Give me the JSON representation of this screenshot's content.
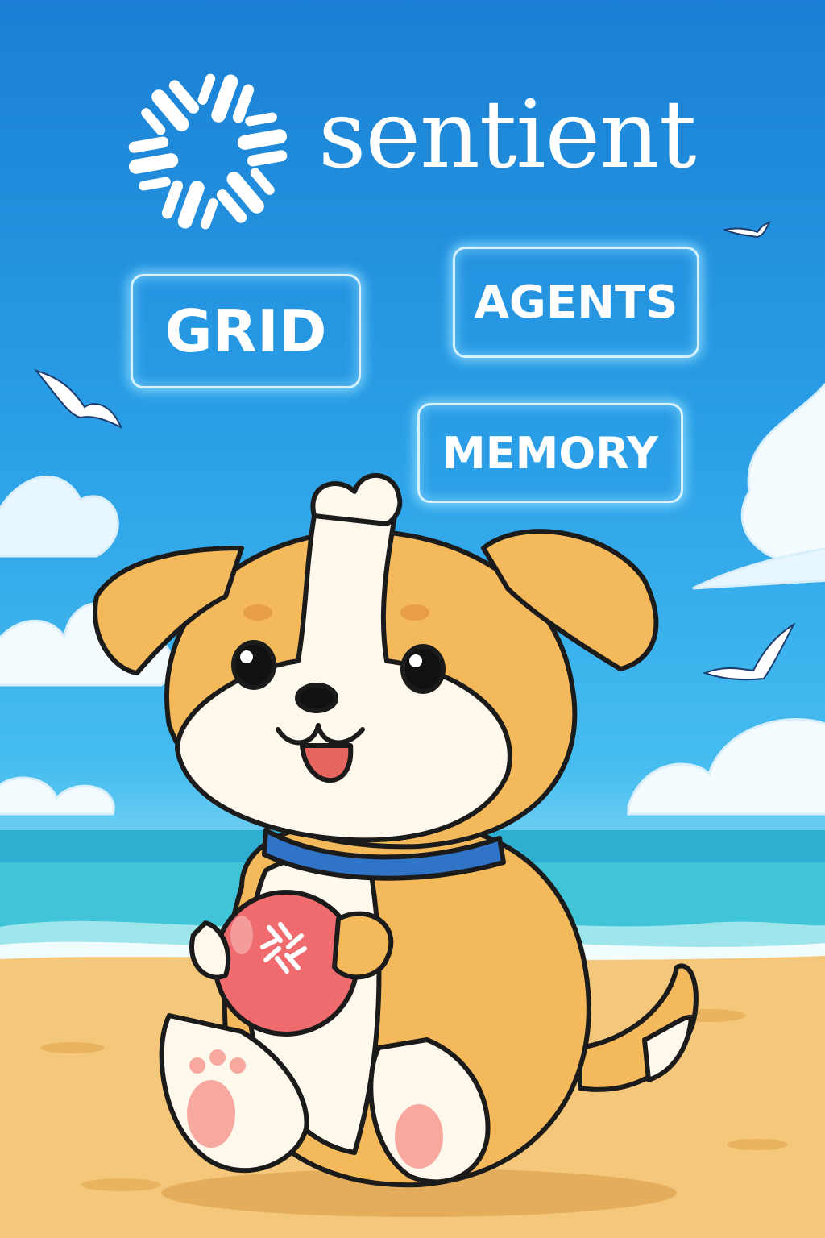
{
  "brand": {
    "name": "sentient",
    "logo_icon": "sentient-knot-logo"
  },
  "tags": {
    "grid": "GRID",
    "agents": "AGENTS",
    "memory": "MEMORY"
  },
  "colors": {
    "sky_top": "#1a7fd4",
    "sky_bottom": "#7fd6f3",
    "sea": "#3fc4d8",
    "sand": "#f4c77a",
    "dog_fur": "#f4b95a",
    "dog_white": "#fff8ec",
    "collar": "#2f74c6",
    "ball": "#ef6b6e",
    "tag_glow": "#8cdcff"
  },
  "scene": {
    "subject": "puppy-holding-ball",
    "icons": [
      "seagull-icon",
      "cloud-icon",
      "sentient-knot-logo"
    ]
  }
}
